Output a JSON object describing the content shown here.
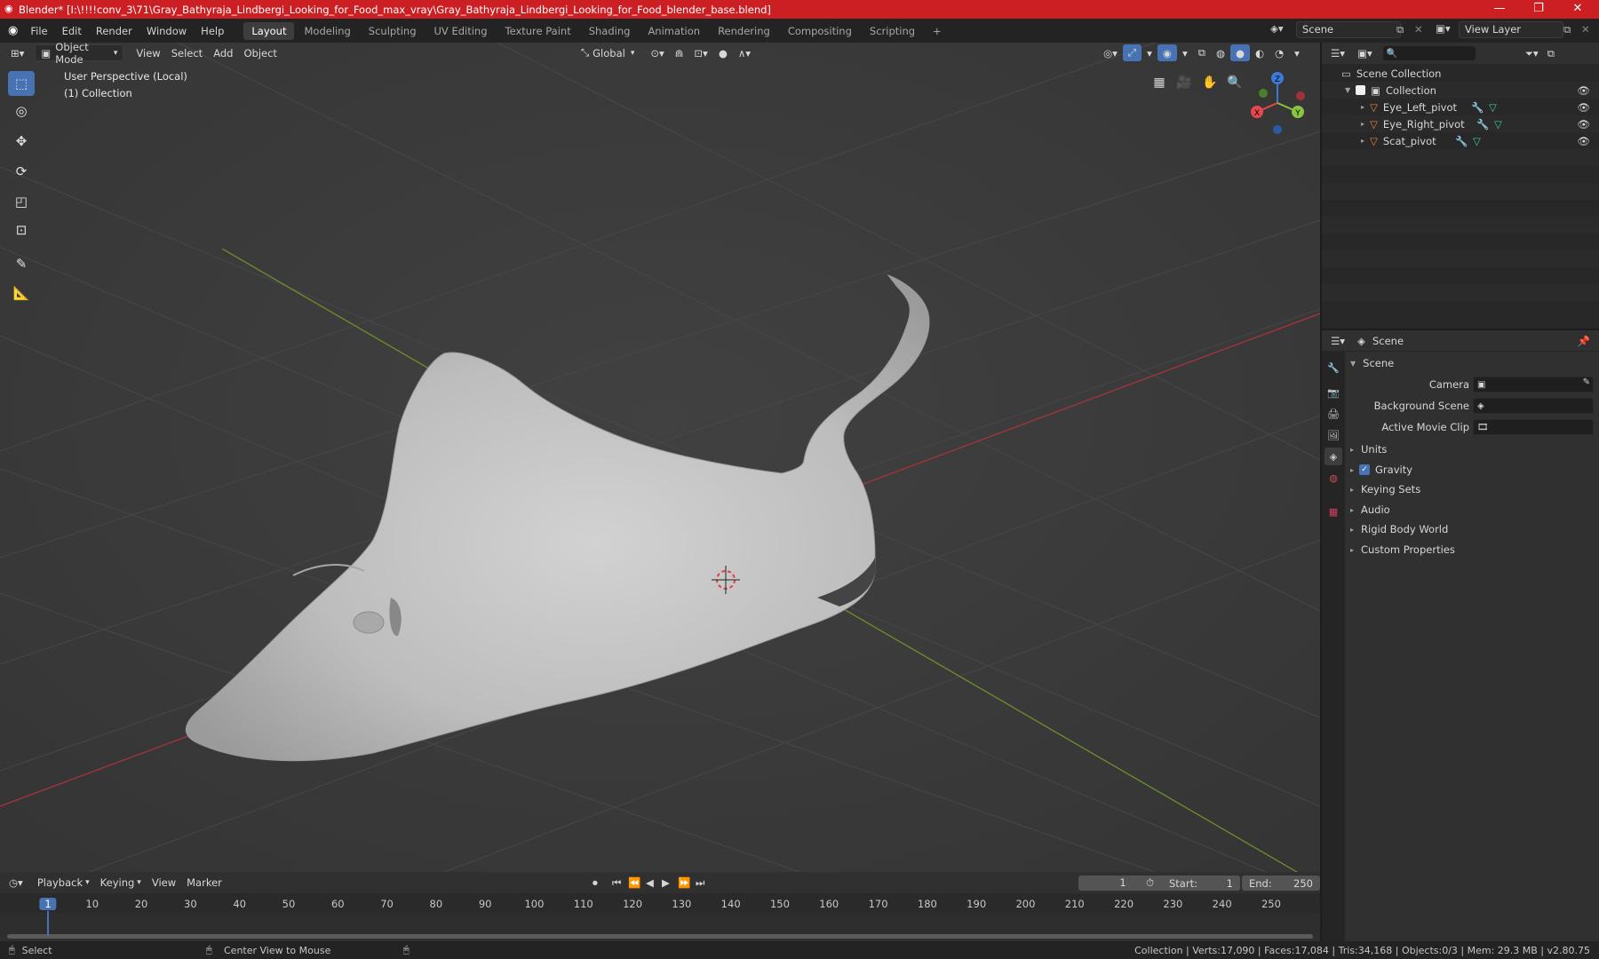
{
  "window": {
    "title": "Blender* [I:\\!!!!conv_3\\71\\Gray_Bathyraja_Lindbergi_Looking_for_Food_max_vray\\Gray_Bathyraja_Lindbergi_Looking_for_Food_blender_base.blend]",
    "minimize": "—",
    "maximize": "❐",
    "close": "✕"
  },
  "menu": {
    "items": [
      "File",
      "Edit",
      "Render",
      "Window",
      "Help"
    ],
    "workspaces": [
      "Layout",
      "Modeling",
      "Sculpting",
      "UV Editing",
      "Texture Paint",
      "Shading",
      "Animation",
      "Rendering",
      "Compositing",
      "Scripting"
    ],
    "add_workspace": "+",
    "scene": "Scene",
    "view_layer": "View Layer"
  },
  "viewport": {
    "mode": "Object Mode",
    "menus": [
      "View",
      "Select",
      "Add",
      "Object"
    ],
    "orientation": "Global",
    "perspective_label": "User Perspective (Local)",
    "collection_label": "(1) Collection",
    "gizmo": {
      "z": "Z",
      "x": "X",
      "y": "Y"
    }
  },
  "outliner": {
    "root": "Scene Collection",
    "collection": "Collection",
    "objects": [
      "Eye_Left_pivot",
      "Eye_Right_pivot",
      "Scat_pivot"
    ]
  },
  "properties": {
    "header": "Scene",
    "panel": "Scene",
    "camera_label": "Camera",
    "background_scene_label": "Background Scene",
    "active_movie_clip_label": "Active Movie Clip",
    "sections": [
      "Units",
      "Gravity",
      "Keying Sets",
      "Audio",
      "Rigid Body World",
      "Custom Properties"
    ],
    "gravity_checked": true
  },
  "timeline": {
    "menus": [
      "Playback",
      "Keying",
      "View",
      "Marker"
    ],
    "current_frame": "1",
    "start_label": "Start:",
    "start": "1",
    "end_label": "End:",
    "end": "250",
    "ticks": [
      "1",
      "10",
      "20",
      "30",
      "40",
      "50",
      "60",
      "70",
      "80",
      "90",
      "100",
      "110",
      "120",
      "130",
      "140",
      "150",
      "160",
      "170",
      "180",
      "190",
      "200",
      "210",
      "220",
      "230",
      "240",
      "250"
    ]
  },
  "status": {
    "select": "Select",
    "center_view": "Center View to Mouse",
    "stats": "Collection | Verts:17,090 | Faces:17,084 | Tris:34,168 | Objects:0/3 | Mem: 29.3 MB | v2.80.75"
  },
  "colors": {
    "title_bar": "#cc1f24",
    "active_tool": "#4772b3",
    "x_axis": "#e8474d",
    "y_axis": "#8bc53f",
    "z_axis": "#3b7ad8",
    "object_icon": "#e5843a"
  }
}
